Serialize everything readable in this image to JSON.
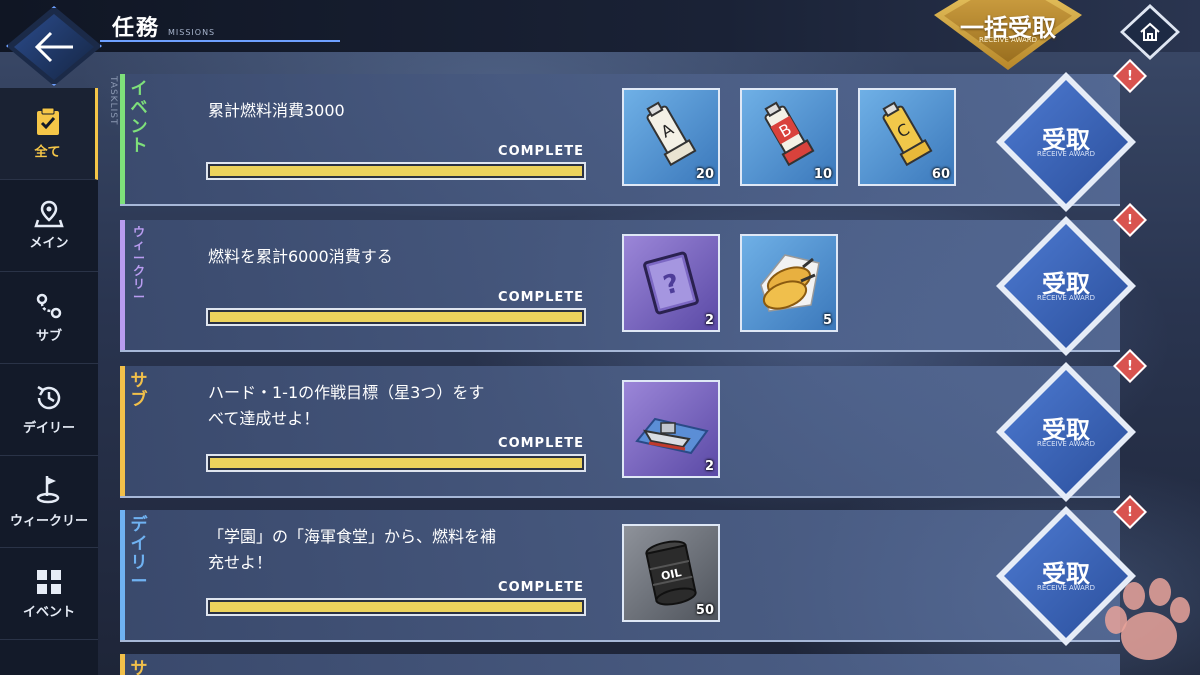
{
  "header": {
    "title": "任務",
    "subtitle": "MISSIONS",
    "bulk_receive_label": "一括受取",
    "bulk_receive_sub": "RECEIVE AWARD"
  },
  "sidebar": {
    "tasklist_label": "TASKLIST",
    "items": [
      {
        "label": "全て",
        "icon": "checklist-icon",
        "active": true
      },
      {
        "label": "メイン",
        "icon": "map-pin-icon",
        "active": false
      },
      {
        "label": "サブ",
        "icon": "route-icon",
        "active": false
      },
      {
        "label": "デイリー",
        "icon": "clock-icon",
        "active": false
      },
      {
        "label": "ウィークリー",
        "icon": "flag-icon",
        "active": false
      },
      {
        "label": "イベント",
        "icon": "grid-icon",
        "active": false
      }
    ]
  },
  "missions": [
    {
      "category": "イベント",
      "category_color": "#7ee07a",
      "description_line1": "累計燃料消費3000",
      "description_line2": "",
      "status": "COMPLETE",
      "progress": 1.0,
      "rewards": [
        {
          "name": "tube-a-icon",
          "qty": "20"
        },
        {
          "name": "tube-b-icon",
          "qty": "10"
        },
        {
          "name": "tube-c-icon",
          "qty": "60"
        }
      ],
      "receive_label": "受取",
      "receive_sub": "RECEIVE AWARD"
    },
    {
      "category": "ウィークリー",
      "category_color": "#b99cf0",
      "description_line1": "燃料を累計6000消費する",
      "description_line2": "",
      "status": "COMPLETE",
      "progress": 1.0,
      "rewards": [
        {
          "name": "mystery-book-icon",
          "qty": "2"
        },
        {
          "name": "fried-food-icon",
          "qty": "5"
        }
      ],
      "receive_label": "受取",
      "receive_sub": "RECEIVE AWARD"
    },
    {
      "category": "サブ",
      "category_color": "#f2c04a",
      "description_line1": "ハード・1-1の作戦目標（星3つ）をす",
      "description_line2": "べて達成せよ！",
      "status": "COMPLETE",
      "progress": 1.0,
      "rewards": [
        {
          "name": "ship-map-icon",
          "qty": "2"
        }
      ],
      "receive_label": "受取",
      "receive_sub": "RECEIVE AWARD"
    },
    {
      "category": "デイリー",
      "category_color": "#6fb2f2",
      "description_line1": "「学園」の「海軍食堂」から、燃料を補",
      "description_line2": "充せよ！",
      "status": "COMPLETE",
      "progress": 1.0,
      "rewards": [
        {
          "name": "oil-barrel-icon",
          "qty": "50",
          "barrel_text": "OIL"
        }
      ],
      "receive_label": "受取",
      "receive_sub": "RECEIVE AWARD"
    },
    {
      "category": "サ",
      "category_color": "#f2c04a"
    }
  ],
  "alert_mark": "!"
}
